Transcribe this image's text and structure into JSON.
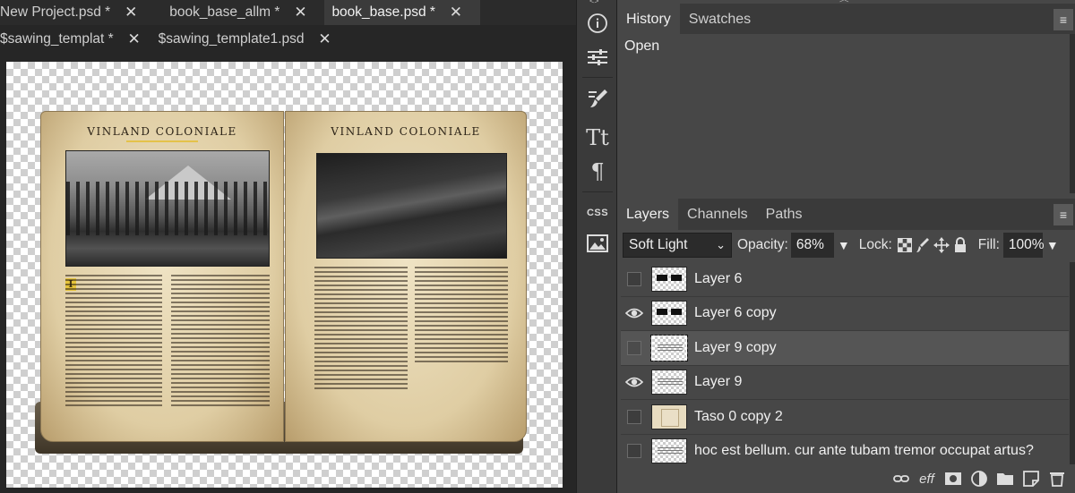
{
  "tabs_row1": [
    {
      "label": "New Project.psd *",
      "active": false
    },
    {
      "label": "book_base_allm *",
      "active": false
    },
    {
      "label": "book_base.psd *",
      "active": true
    }
  ],
  "tabs_row2": [
    {
      "label": "$sawing_templat *",
      "active": false
    },
    {
      "label": "$sawing_template1.psd",
      "active": false
    }
  ],
  "canvas": {
    "book_title_left": "VINLAND COLONIALE",
    "book_title_right": "VINLAND COLONIALE",
    "dropcap": "I"
  },
  "tools": {
    "collapse_left": "<>",
    "collapse_right": "><",
    "info_icon": "info-icon",
    "adjust_icon": "sliders-icon",
    "brush_icon": "brush-icon",
    "type_glyph": "Tt",
    "paragraph_glyph": "¶",
    "css_label": "CSS",
    "image_icon": "image-icon"
  },
  "history_panel": {
    "tabs": [
      "History",
      "Swatches"
    ],
    "menu": "≡",
    "items": [
      "Open"
    ]
  },
  "layers_panel": {
    "tabs": [
      "Layers",
      "Channels",
      "Paths"
    ],
    "menu": "≡",
    "blend_mode": "Soft Light",
    "opacity_label": "Opacity:",
    "opacity_value": "68%",
    "lock_label": "Lock:",
    "fill_label": "Fill:",
    "fill_value": "100%",
    "layers": [
      {
        "name": "Layer 6",
        "visible": false,
        "selected": false,
        "thumb": "black-bars"
      },
      {
        "name": "Layer 6 copy",
        "visible": true,
        "selected": false,
        "thumb": "black-bars"
      },
      {
        "name": "Layer 9 copy",
        "visible": false,
        "selected": true,
        "thumb": "text"
      },
      {
        "name": "Layer 9",
        "visible": true,
        "selected": false,
        "thumb": "text"
      },
      {
        "name": "Taso 0 copy 2",
        "visible": false,
        "selected": false,
        "thumb": "beige"
      },
      {
        "name": "hoc est bellum. cur ante tubam tremor occupat artus?",
        "visible": false,
        "selected": false,
        "thumb": "text"
      }
    ],
    "footer_eff_label": "eff"
  },
  "colors": {
    "panel_bg": "#474747",
    "toolbar_bg": "#3a3a3a",
    "canvas_frame": "#262626",
    "accent_underline": "#e4c24a"
  }
}
